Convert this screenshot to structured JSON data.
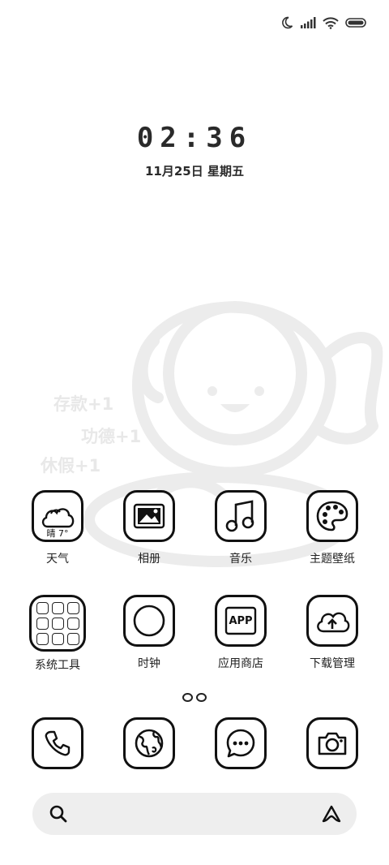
{
  "status_bar": {
    "icons": [
      "moon-icon",
      "signal-icon",
      "wifi-icon",
      "battery-icon"
    ]
  },
  "lockscreen": {
    "time": "02:36",
    "date": "11月25日  星期五"
  },
  "wallpaper": {
    "texts": [
      "存款+1",
      "功德+1",
      "休假+1"
    ]
  },
  "apps": [
    {
      "label": "天气",
      "icon": "cloud-icon",
      "extra": "晴 7°"
    },
    {
      "label": "相册",
      "icon": "picture-icon"
    },
    {
      "label": "音乐",
      "icon": "music-note-icon"
    },
    {
      "label": "主题壁纸",
      "icon": "palette-icon"
    },
    {
      "label": "系统工具",
      "icon": "folder-icon"
    },
    {
      "label": "时钟",
      "icon": "clock-icon"
    },
    {
      "label": "应用商店",
      "icon": "app-store-icon",
      "extra": "APP"
    },
    {
      "label": "下载管理",
      "icon": "cloud-download-icon"
    }
  ],
  "dock": [
    {
      "icon": "phone-icon"
    },
    {
      "icon": "browser-globe-icon"
    },
    {
      "icon": "messages-icon"
    },
    {
      "icon": "camera-icon"
    }
  ],
  "search": {
    "icon": "search-icon",
    "assistant_icon": "assistant-icon"
  }
}
